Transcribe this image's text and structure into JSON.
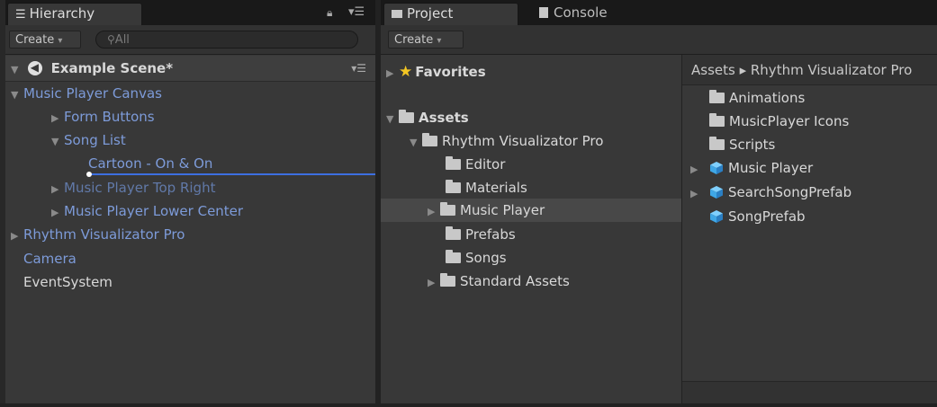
{
  "hierarchy": {
    "tab_label": "Hierarchy",
    "create_label": "Create",
    "search_placeholder": "All",
    "scene_name": "Example Scene*",
    "items": [
      {
        "label": "Music Player Canvas"
      },
      {
        "label": "Form Buttons"
      },
      {
        "label": "Song List"
      },
      {
        "label": "Cartoon - On & On"
      },
      {
        "label": "Music Player Top Right"
      },
      {
        "label": "Music Player Lower Center"
      },
      {
        "label": "Rhythm Visualizator Pro"
      },
      {
        "label": "Camera"
      },
      {
        "label": "EventSystem"
      }
    ]
  },
  "project": {
    "tab_label": "Project",
    "console_tab_label": "Console",
    "create_label": "Create",
    "favorites_label": "Favorites",
    "assets_label": "Assets",
    "tree": [
      {
        "label": "Rhythm Visualizator Pro"
      },
      {
        "label": "Editor"
      },
      {
        "label": "Materials"
      },
      {
        "label": "Music Player"
      },
      {
        "label": "Prefabs"
      },
      {
        "label": "Songs"
      },
      {
        "label": "Standard Assets"
      }
    ],
    "breadcrumb": "Assets ▸ Rhythm Visualizator Pro",
    "contents": [
      {
        "label": "Animations"
      },
      {
        "label": "MusicPlayer Icons"
      },
      {
        "label": "Scripts"
      },
      {
        "label": "Music Player"
      },
      {
        "label": "SearchSongPrefab"
      },
      {
        "label": "SongPrefab"
      }
    ]
  },
  "colors": {
    "panel_bg": "#383838",
    "hierarchy_text_blue": "#7d9bd9",
    "selected_row": "#484848",
    "drop_indicator": "#3d6fe0"
  }
}
